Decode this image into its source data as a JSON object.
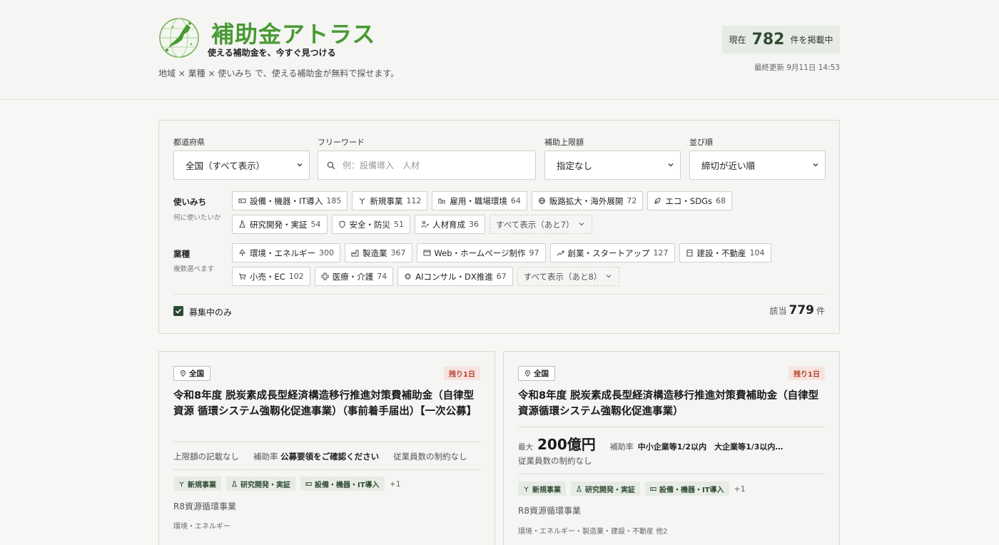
{
  "header": {
    "title": "補助金アトラス",
    "tagline": "使える補助金を、今すぐ見つける",
    "description": "地域 × 業種 × 使いみち で、使える補助金が無料で探せます。",
    "count_prefix": "現在",
    "count": "782",
    "count_suffix": "件を掲載中",
    "updated": "最終更新 9月11日 14:53",
    "brand_color": "#4a9a34"
  },
  "filters": {
    "prefecture": {
      "label": "都道府県",
      "value": "全国（すべて表示）"
    },
    "keyword": {
      "label": "フリーワード",
      "placeholder": "例：設備導入　人材",
      "value": ""
    },
    "limit": {
      "label": "補助上限額",
      "value": "指定なし"
    },
    "sort": {
      "label": "並び順",
      "value": "締切が近い順"
    },
    "usage": {
      "label": "使いみち",
      "sub": "何に使いたいか",
      "items": [
        {
          "icon": "equipment-icon",
          "label": "設備・機器・IT導入",
          "count": "185"
        },
        {
          "icon": "sprout-icon",
          "label": "新規事業",
          "count": "112"
        },
        {
          "icon": "people-icon",
          "label": "雇用・職場環境",
          "count": "64"
        },
        {
          "icon": "globe-icon",
          "label": "販路拡大・海外展開",
          "count": "72"
        },
        {
          "icon": "leaf-icon",
          "label": "エコ・SDGs",
          "count": "68"
        },
        {
          "icon": "flask-icon",
          "label": "研究開発・実証",
          "count": "54"
        },
        {
          "icon": "shield-icon",
          "label": "安全・防災",
          "count": "51"
        },
        {
          "icon": "person-growth-icon",
          "label": "人材育成",
          "count": "36"
        }
      ],
      "more": "すべて表示（あと7）"
    },
    "industry": {
      "label": "業種",
      "sub": "複数選べます",
      "items": [
        {
          "icon": "tree-icon",
          "label": "環境・エネルギー",
          "count": "300"
        },
        {
          "icon": "factory-icon",
          "label": "製造業",
          "count": "367"
        },
        {
          "icon": "browser-icon",
          "label": "Web・ホームページ制作",
          "count": "97"
        },
        {
          "icon": "chart-up-icon",
          "label": "創業・スタートアップ",
          "count": "127"
        },
        {
          "icon": "building-icon",
          "label": "建設・不動産",
          "count": "104"
        },
        {
          "icon": "cart-icon",
          "label": "小売・EC",
          "count": "102"
        },
        {
          "icon": "medical-cross-icon",
          "label": "医療・介護",
          "count": "74"
        },
        {
          "icon": "chip-icon",
          "label": "AIコンサル・DX推進",
          "count": "67"
        }
      ],
      "more": "すべて表示（あと8）"
    },
    "open_only": "募集中のみ",
    "result_prefix": "該当",
    "result_count": "779",
    "result_suffix": "件"
  },
  "cards": [
    {
      "region": "全国",
      "deadline": "残り1日",
      "title": "令和8年度 脱炭素成長型経済構造移行推進対策費補助金（自律型資源 循環システム強靱化促進事業）（事前着手届出）【一次公募】",
      "limit": "上限額の記載なし",
      "rate_label": "補助率",
      "rate": "公募要領をご確認ください",
      "employees": "従業員数の制約なし",
      "tags": [
        {
          "icon": "sprout-icon",
          "label": "新規事業"
        },
        {
          "icon": "flask-icon",
          "label": "研究開発・実証"
        },
        {
          "icon": "equipment-icon",
          "label": "設備・機器・IT導入"
        }
      ],
      "tags_more": "+1",
      "program": "R8資源循環事業",
      "categories": "環境・エネルギー"
    },
    {
      "region": "全国",
      "deadline": "残り1日",
      "title": "令和8年度 脱炭素成長型経済構造移行推進対策費補助金（自律型資源循環システム強靱化促進事業）",
      "max_label": "最大",
      "max_value": "200億円",
      "rate_label": "補助率",
      "rate": "中小企業等1/2以内　大企業等1/3以内…",
      "employees": "従業員数の制約なし",
      "tags": [
        {
          "icon": "sprout-icon",
          "label": "新規事業"
        },
        {
          "icon": "flask-icon",
          "label": "研究開発・実証"
        },
        {
          "icon": "equipment-icon",
          "label": "設備・機器・IT導入"
        }
      ],
      "tags_more": "+1",
      "program": "R8資源循環事業",
      "categories": "環境・エネルギー・製造業・建設・不動産 他2"
    }
  ]
}
